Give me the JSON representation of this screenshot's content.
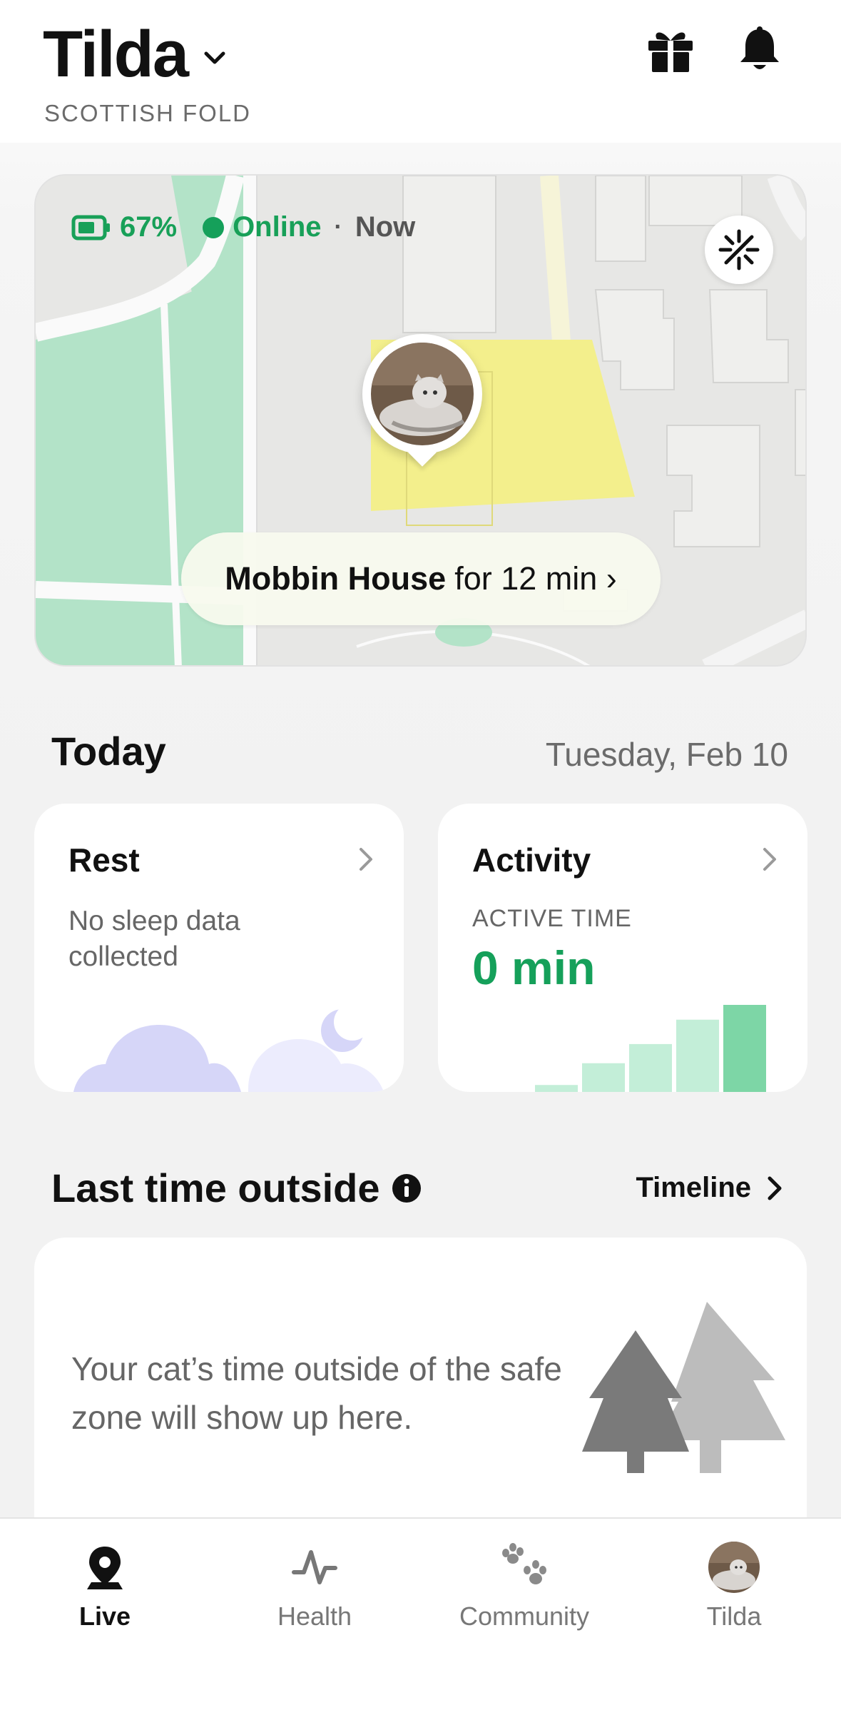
{
  "header": {
    "pet_name": "Tilda",
    "breed": "SCOTTISH FOLD",
    "gift_icon": "gift-icon",
    "bell_icon": "bell-icon"
  },
  "map": {
    "battery": "67%",
    "status": "Online",
    "separator": "·",
    "updated": "Now",
    "place": "Mobbin House",
    "duration": "for 12 min ›",
    "recenter_icon": "recenter-icon"
  },
  "today": {
    "title": "Today",
    "date": "Tuesday, Feb 10",
    "rest": {
      "title": "Rest",
      "message": "No sleep data collected"
    },
    "activity": {
      "title": "Activity",
      "label": "ACTIVE TIME",
      "value": "0 min",
      "bar_levels": [
        0.08,
        0.33,
        0.55,
        0.83,
        1.0
      ]
    }
  },
  "outside": {
    "title": "Last time outside",
    "link": "Timeline",
    "message": "Your cat’s time outside of the safe zone will show up here."
  },
  "nav": {
    "items": [
      {
        "label": "Live",
        "icon": "location-pin-icon",
        "active": true
      },
      {
        "label": "Health",
        "icon": "pulse-icon",
        "active": false
      },
      {
        "label": "Community",
        "icon": "paw-icon",
        "active": false
      },
      {
        "label": "Tilda",
        "icon": "pet-avatar",
        "active": false
      }
    ]
  },
  "colors": {
    "accent_green": "#15a05a",
    "map_park": "#b2e2c7",
    "safe_zone": "#f2ef8e",
    "cloud": "#d6d6f8",
    "activity_bar": "#c3eed8",
    "activity_bar_top": "#7dd6a6"
  }
}
